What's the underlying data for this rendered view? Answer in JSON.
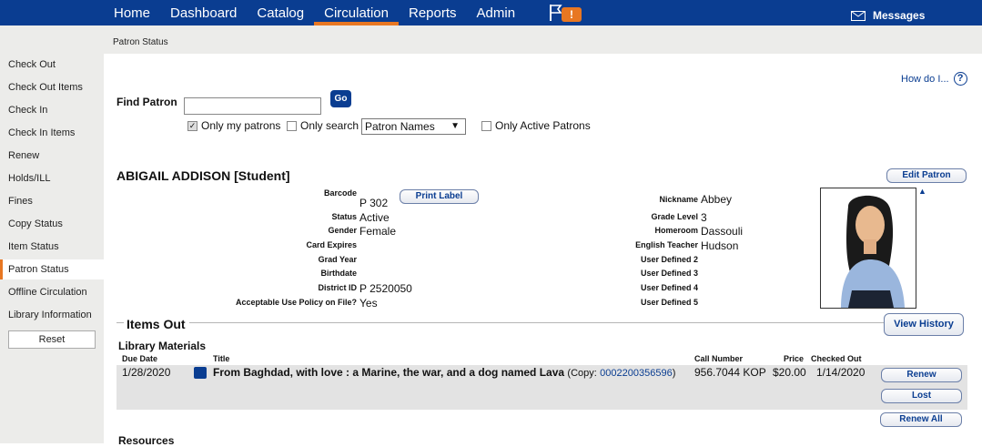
{
  "nav": {
    "items": [
      "Home",
      "Dashboard",
      "Catalog",
      "Circulation",
      "Reports",
      "Admin"
    ],
    "active": "Circulation",
    "alert_badge": "!",
    "messages_label": "Messages"
  },
  "subbar": {
    "title": "Patron Status"
  },
  "sidebar": {
    "items": [
      "Check Out",
      "Check Out Items",
      "Check In",
      "Check In Items",
      "Renew",
      "Holds/ILL",
      "Fines",
      "Copy Status",
      "Item Status",
      "Patron Status",
      "Offline Circulation",
      "Library Information"
    ],
    "active_index": 9,
    "reset_label": "Reset"
  },
  "help": {
    "label": "How do I...",
    "icon": "?"
  },
  "find": {
    "label": "Find Patron",
    "value": "",
    "go_label": "Go",
    "only_my_patrons": "Only my patrons",
    "only_my_patrons_checked": true,
    "only_search": "Only search",
    "only_search_checked": false,
    "search_type": "Patron Names",
    "only_active": "Only Active Patrons",
    "only_active_checked": false
  },
  "patron": {
    "name": "ABIGAIL ADDISON [Student]",
    "edit_label": "Edit Patron",
    "print_label": "Print Label",
    "left_fields": [
      {
        "label": "Barcode",
        "value": "P 302"
      },
      {
        "label": "Status",
        "value": "Active"
      },
      {
        "label": "Gender",
        "value": "Female"
      },
      {
        "label": "Card Expires",
        "value": ""
      },
      {
        "label": "Grad Year",
        "value": ""
      },
      {
        "label": "Birthdate",
        "value": ""
      },
      {
        "label": "District ID",
        "value": "P 2520050"
      },
      {
        "label": "Acceptable Use Policy on File?",
        "value": "Yes"
      }
    ],
    "right_fields": [
      {
        "label": "Nickname",
        "value": "Abbey"
      },
      {
        "label": "Grade Level",
        "value": "3"
      },
      {
        "label": "Homeroom",
        "value": "Dassouli"
      },
      {
        "label": "English Teacher",
        "value": "Hudson"
      },
      {
        "label": "User Defined 2",
        "value": ""
      },
      {
        "label": "User Defined 3",
        "value": ""
      },
      {
        "label": "User Defined 4",
        "value": ""
      },
      {
        "label": "User Defined 5",
        "value": ""
      }
    ]
  },
  "items_out": {
    "title": "Items Out",
    "view_history_label": "View History",
    "library_materials": "Library Materials",
    "headers": {
      "due_date": "Due Date",
      "title": "Title",
      "call_number": "Call Number",
      "price": "Price",
      "checked_out": "Checked Out"
    },
    "rows": [
      {
        "due_date": "1/28/2020",
        "title": "From Baghdad, with love : a Marine, the war, and a dog named Lava",
        "copy_prefix": "(Copy:",
        "copy_barcode": "0002200356596",
        "copy_suffix": ")",
        "call_number": "956.7044 KOP",
        "price": "$20.00",
        "checked_out": "1/14/2020"
      }
    ],
    "renew_label": "Renew",
    "lost_label": "Lost",
    "renew_all_label": "Renew All",
    "resources": "Resources"
  }
}
